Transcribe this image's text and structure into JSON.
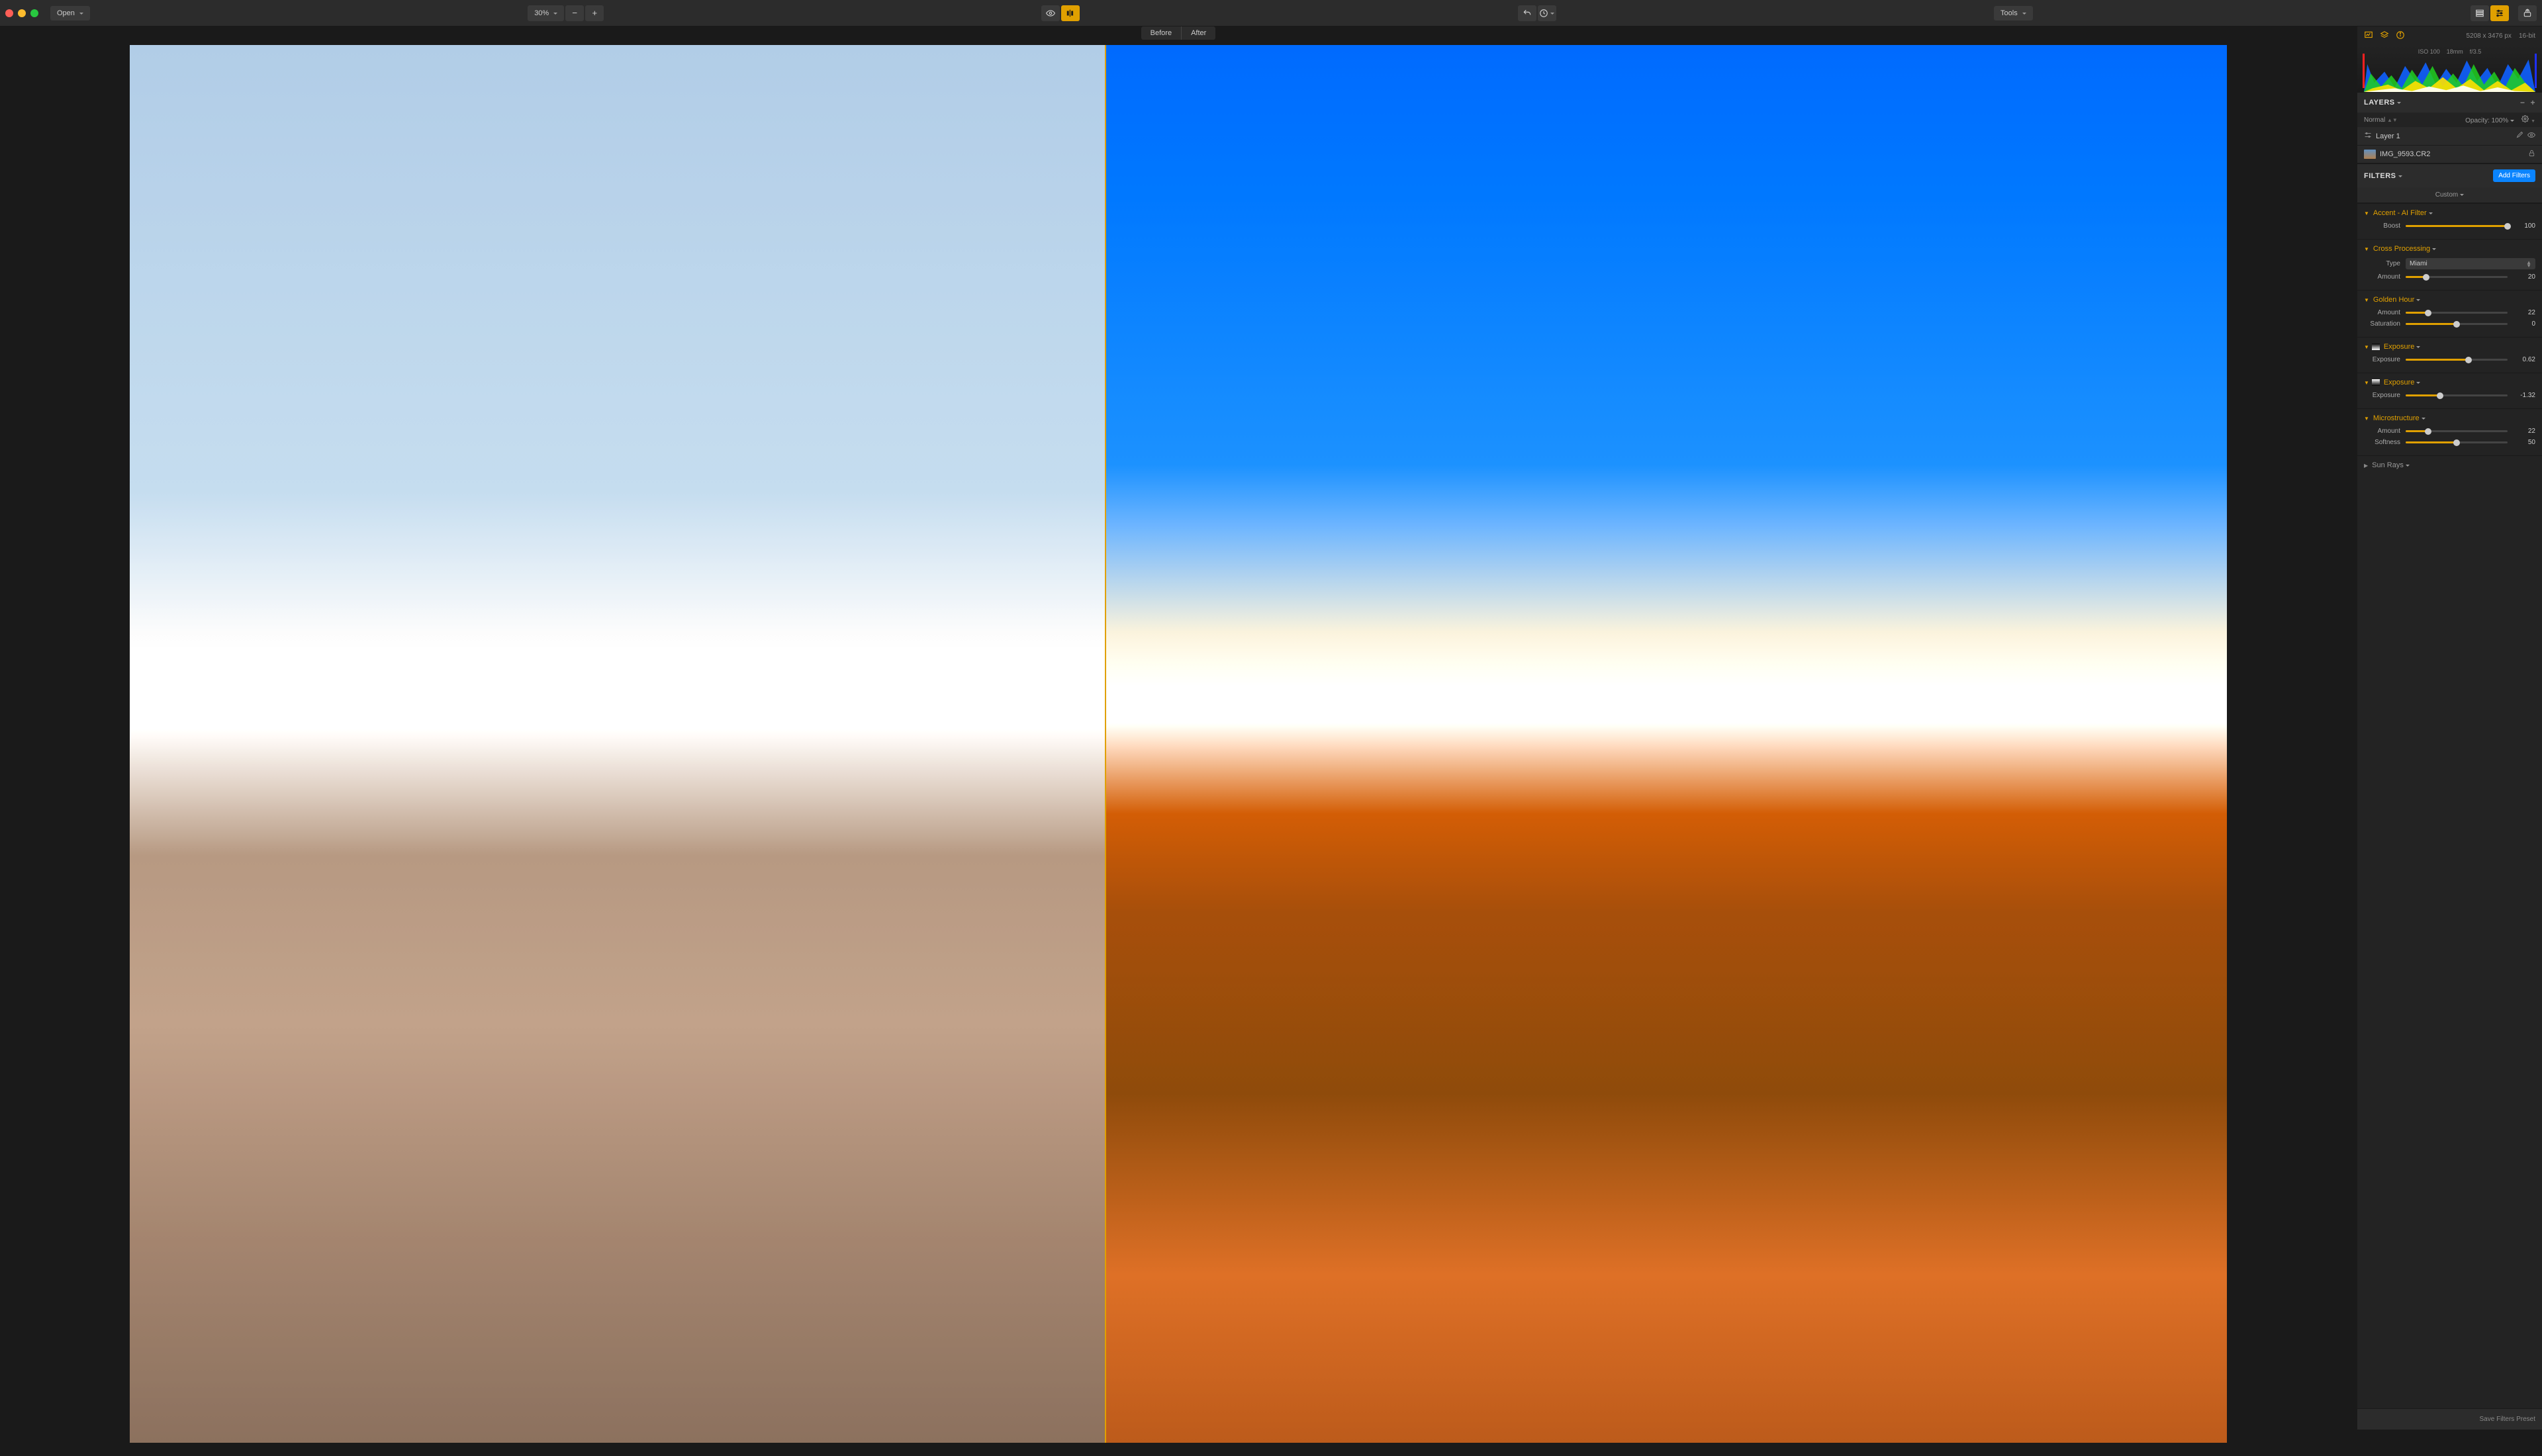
{
  "toolbar": {
    "open_label": "Open",
    "zoom": "30%",
    "tools_label": "Tools"
  },
  "compare": {
    "before": "Before",
    "after": "After"
  },
  "meta": {
    "dimensions": "5208 x 3476 px",
    "bitdepth": "16-bit",
    "iso": "ISO 100",
    "focal": "18mm",
    "aperture": "f/3.5"
  },
  "layers": {
    "title": "LAYERS",
    "blend_mode": "Normal",
    "opacity_label": "Opacity:",
    "opacity_value": "100%",
    "items": [
      {
        "name": "Layer 1"
      },
      {
        "name": "IMG_9593.CR2"
      }
    ]
  },
  "filters": {
    "title": "FILTERS",
    "add_btn": "Add Filters",
    "preset": "Custom",
    "save_preset": "Save Filters Preset",
    "blocks": [
      {
        "name": "Accent - AI Filter",
        "controls": [
          {
            "label": "Boost",
            "value": 100,
            "pct": 100
          }
        ]
      },
      {
        "name": "Cross Processing",
        "select": {
          "label": "Type",
          "value": "Miami"
        },
        "controls": [
          {
            "label": "Amount",
            "value": 20,
            "pct": 20
          }
        ]
      },
      {
        "name": "Golden Hour",
        "controls": [
          {
            "label": "Amount",
            "value": 22,
            "pct": 22
          },
          {
            "label": "Saturation",
            "value": 0,
            "pct": 50
          }
        ]
      },
      {
        "name": "Exposure",
        "swatch": "exp1",
        "controls": [
          {
            "label": "Exposure",
            "value": 0.62,
            "pct": 62
          }
        ]
      },
      {
        "name": "Exposure",
        "swatch": "exp2",
        "controls": [
          {
            "label": "Exposure",
            "value": -1.32,
            "pct": 34
          }
        ]
      },
      {
        "name": "Microstructure",
        "controls": [
          {
            "label": "Amount",
            "value": 22,
            "pct": 22
          },
          {
            "label": "Softness",
            "value": 50,
            "pct": 50
          }
        ]
      },
      {
        "name": "Sun Rays",
        "collapsed": true
      }
    ]
  }
}
